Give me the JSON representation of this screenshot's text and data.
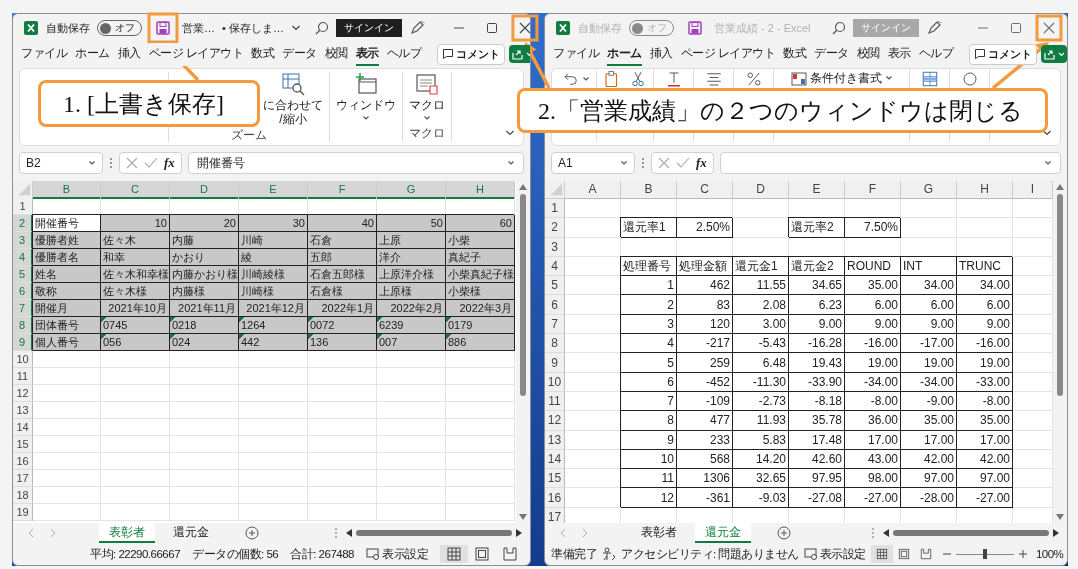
{
  "windows": [
    {
      "active": true,
      "autosave": {
        "label": "自動保存",
        "state_text": "オフ",
        "on": false
      },
      "title_parts": [
        "営業…",
        "• 保存しま…"
      ],
      "title_menu": true,
      "signin": "サインイン",
      "menu_tabs": [
        {
          "label": "ファイル",
          "selected": false
        },
        {
          "label": "ホーム",
          "selected": false
        },
        {
          "label": "挿入",
          "selected": false
        },
        {
          "label": "ページ レイアウト",
          "selected": false
        },
        {
          "label": "数式",
          "selected": false
        },
        {
          "label": "データ",
          "selected": false
        },
        {
          "label": "校閲",
          "selected": false
        },
        {
          "label": "表示",
          "selected": true
        },
        {
          "label": "ヘルプ",
          "selected": false
        }
      ],
      "comment_button": "コメント",
      "ribbon": [
        {
          "label": "ズーム",
          "buttons": [
            {
              "kind": "zoomfit",
              "label": "に合わせて\n/縮小",
              "menu": false
            }
          ]
        },
        {
          "buttons": [
            {
              "kind": "window",
              "label": "ウィンドウ",
              "menu": true
            }
          ]
        },
        {
          "label": "マクロ",
          "buttons": [
            {
              "kind": "macro",
              "label": "マクロ",
              "menu": true
            }
          ]
        }
      ],
      "name_box": "B2",
      "fx": "fx",
      "formula": "開催番号",
      "columns": [
        {
          "label": "B",
          "selected": true
        },
        {
          "label": "C",
          "selected": true
        },
        {
          "label": "D",
          "selected": true
        },
        {
          "label": "E",
          "selected": true
        },
        {
          "label": "F",
          "selected": true
        },
        {
          "label": "G",
          "selected": true
        },
        {
          "label": "H",
          "selected": true
        }
      ],
      "rows": [
        {
          "header": "1",
          "selected": false
        },
        {
          "header": "2",
          "selected": true,
          "bordered": true,
          "cells": [
            {
              "text": "開催番号",
              "active": true
            },
            {
              "text": "10",
              "numeric": true
            },
            {
              "text": "20",
              "numeric": true
            },
            {
              "text": "30",
              "numeric": true
            },
            {
              "text": "40",
              "numeric": true
            },
            {
              "text": "50",
              "numeric": true
            },
            {
              "text": "60",
              "numeric": true
            }
          ]
        },
        {
          "header": "3",
          "selected": true,
          "bordered": true,
          "cells": [
            "優勝者姓",
            "佐々木",
            "内藤",
            "川崎",
            "石倉",
            "上原",
            "小柴"
          ]
        },
        {
          "header": "4",
          "selected": true,
          "bordered": true,
          "cells": [
            "優勝者名",
            "和幸",
            "かおり",
            "綾",
            "五郎",
            "洋介",
            "真紀子"
          ]
        },
        {
          "header": "5",
          "selected": true,
          "bordered": true,
          "cells": [
            "姓名",
            "佐々木和幸様",
            "内藤かおり様",
            "川崎綾様",
            "石倉五郎様",
            "上原洋介様",
            "小柴真紀子様"
          ]
        },
        {
          "header": "6",
          "selected": true,
          "bordered": true,
          "cells": [
            "敬称",
            "佐々木様",
            "内藤様",
            "川崎様",
            "石倉様",
            "上原様",
            "小柴様"
          ]
        },
        {
          "header": "7",
          "selected": true,
          "bordered": true,
          "cells": [
            "開催月",
            {
              "text": "2021年10月",
              "numeric": true
            },
            {
              "text": "2021年11月",
              "numeric": true
            },
            {
              "text": "2021年12月",
              "numeric": true
            },
            {
              "text": "2022年1月",
              "numeric": true
            },
            {
              "text": "2022年2月",
              "numeric": true
            },
            {
              "text": "2022年3月",
              "numeric": true
            }
          ]
        },
        {
          "header": "8",
          "selected": true,
          "bordered": true,
          "cells": [
            "団体番号",
            {
              "text": "0745",
              "flag": true
            },
            {
              "text": "0218",
              "flag": true
            },
            {
              "text": "1264",
              "flag": true
            },
            {
              "text": "0072",
              "flag": true
            },
            {
              "text": "6239",
              "flag": true
            },
            {
              "text": "0179",
              "flag": true
            }
          ]
        },
        {
          "header": "9",
          "selected": true,
          "bordered": true,
          "cells": [
            "個人番号",
            {
              "text": "056",
              "flag": true
            },
            {
              "text": "024",
              "flag": true
            },
            {
              "text": "442",
              "flag": true
            },
            {
              "text": "136",
              "flag": true
            },
            {
              "text": "007",
              "flag": true
            },
            {
              "text": "886",
              "flag": true
            }
          ]
        },
        {
          "header": "10",
          "selected": false
        },
        {
          "header": "11",
          "selected": false
        },
        {
          "header": "12",
          "selected": false
        },
        {
          "header": "13",
          "selected": false
        },
        {
          "header": "14",
          "selected": false
        },
        {
          "header": "15",
          "selected": false
        },
        {
          "header": "16",
          "selected": false
        },
        {
          "header": "17",
          "selected": false
        },
        {
          "header": "18",
          "selected": false
        },
        {
          "header": "19",
          "selected": false
        }
      ],
      "sheet_tabs": [
        {
          "label": "表彰者",
          "selected": true
        },
        {
          "label": "還元金",
          "selected": false
        }
      ],
      "status": [
        {
          "kind": "stat",
          "text": "平均: 22290.66667"
        },
        {
          "kind": "stat",
          "text": "データの個数: 56"
        },
        {
          "kind": "stat",
          "text": "合計: 267488"
        }
      ],
      "view_settings": "表示設定"
    },
    {
      "active": false,
      "autosave": {
        "label": "自動保存",
        "state_text": "オフ",
        "on": false
      },
      "title_parts": [
        "営業成績 - 2 - Excel"
      ],
      "title_menu": false,
      "signin": "サインイン",
      "menu_tabs": [
        {
          "label": "ファイル",
          "selected": false
        },
        {
          "label": "ホーム",
          "selected": true
        },
        {
          "label": "挿入",
          "selected": false
        },
        {
          "label": "ページ レイアウト",
          "selected": false
        },
        {
          "label": "数式",
          "selected": false
        },
        {
          "label": "データ",
          "selected": false
        },
        {
          "label": "校閲",
          "selected": false
        },
        {
          "label": "表示",
          "selected": false
        },
        {
          "label": "ヘルプ",
          "selected": false
        }
      ],
      "comment_button": "コメント",
      "ribbon": [
        {
          "buttons": [
            {
              "kind": "undo",
              "menu": true
            }
          ]
        },
        {
          "buttons": [
            {
              "kind": "paste",
              "menu": false
            },
            {
              "kind": "cut",
              "menu": false
            }
          ]
        },
        {
          "buttons": [
            {
              "kind": "font",
              "menu": false
            }
          ]
        },
        {
          "buttons": [
            {
              "kind": "align",
              "menu": false
            }
          ]
        },
        {
          "buttons": [
            {
              "kind": "number",
              "menu": false
            }
          ]
        },
        {
          "buttons": [
            {
              "kind": "condfmt",
              "label": "条件付き書式",
              "menu": true
            }
          ]
        },
        {
          "buttons": [
            {
              "kind": "cells",
              "menu": false
            }
          ]
        },
        {
          "buttons": [
            {
              "kind": "editing",
              "menu": false
            }
          ]
        }
      ],
      "name_box": "A1",
      "fx": "fx",
      "columns": [
        {
          "label": "A",
          "selected": false
        },
        {
          "label": "B",
          "selected": false
        },
        {
          "label": "C",
          "selected": false
        },
        {
          "label": "D",
          "selected": false
        },
        {
          "label": "E",
          "selected": false
        },
        {
          "label": "F",
          "selected": false
        },
        {
          "label": "G",
          "selected": false
        },
        {
          "label": "H",
          "selected": false
        },
        {
          "label": "I",
          "selected": false
        }
      ],
      "rows": [
        {
          "header": "1",
          "selected": false
        },
        {
          "header": "2",
          "selected": false,
          "bordered": true,
          "cells": [
            {},
            "還元率1",
            {
              "text": "2.50%",
              "numeric": true
            },
            {},
            "還元率2",
            {
              "text": "7.50%",
              "numeric": true
            }
          ]
        },
        {
          "header": "3",
          "selected": false
        },
        {
          "header": "4",
          "selected": false,
          "bordered": true,
          "cells": [
            {},
            "処理番号",
            "処理金額",
            "還元金1",
            "還元金2",
            "ROUND",
            "INT",
            "TRUNC"
          ]
        },
        {
          "header": "5",
          "selected": false,
          "bordered": true,
          "numeric": true,
          "cells": [
            {},
            "1",
            "462",
            "11.55",
            "34.65",
            "35.00",
            "34.00",
            "34.00"
          ]
        },
        {
          "header": "6",
          "selected": false,
          "bordered": true,
          "numeric": true,
          "cells": [
            {},
            "2",
            "83",
            "2.08",
            "6.23",
            "6.00",
            "6.00",
            "6.00"
          ]
        },
        {
          "header": "7",
          "selected": false,
          "bordered": true,
          "numeric": true,
          "cells": [
            {},
            "3",
            "120",
            "3.00",
            "9.00",
            "9.00",
            "9.00",
            "9.00"
          ]
        },
        {
          "header": "8",
          "selected": false,
          "bordered": true,
          "numeric": true,
          "cells": [
            {},
            "4",
            "-217",
            "-5.43",
            "-16.28",
            "-16.00",
            "-17.00",
            "-16.00"
          ]
        },
        {
          "header": "9",
          "selected": false,
          "bordered": true,
          "numeric": true,
          "cells": [
            {},
            "5",
            "259",
            "6.48",
            "19.43",
            "19.00",
            "19.00",
            "19.00"
          ]
        },
        {
          "header": "10",
          "selected": false,
          "bordered": true,
          "numeric": true,
          "cells": [
            {},
            "6",
            "-452",
            "-11.30",
            "-33.90",
            "-34.00",
            "-34.00",
            "-33.00"
          ]
        },
        {
          "header": "11",
          "selected": false,
          "bordered": true,
          "numeric": true,
          "cells": [
            {},
            "7",
            "-109",
            "-2.73",
            "-8.18",
            "-8.00",
            "-9.00",
            "-8.00"
          ]
        },
        {
          "header": "12",
          "selected": false,
          "bordered": true,
          "numeric": true,
          "cells": [
            {},
            "8",
            "477",
            "11.93",
            "35.78",
            "36.00",
            "35.00",
            "35.00"
          ]
        },
        {
          "header": "13",
          "selected": false,
          "bordered": true,
          "numeric": true,
          "cells": [
            {},
            "9",
            "233",
            "5.83",
            "17.48",
            "17.00",
            "17.00",
            "17.00"
          ]
        },
        {
          "header": "14",
          "selected": false,
          "bordered": true,
          "numeric": true,
          "cells": [
            {},
            "10",
            "568",
            "14.20",
            "42.60",
            "43.00",
            "42.00",
            "42.00"
          ]
        },
        {
          "header": "15",
          "selected": false,
          "bordered": true,
          "numeric": true,
          "cells": [
            {},
            "11",
            "1306",
            "32.65",
            "97.95",
            "98.00",
            "97.00",
            "97.00"
          ]
        },
        {
          "header": "16",
          "selected": false,
          "bordered": true,
          "numeric": true,
          "cells": [
            {},
            "12",
            "-361",
            "-9.03",
            "-27.08",
            "-27.00",
            "-28.00",
            "-27.00"
          ]
        },
        {
          "header": "17",
          "selected": false
        }
      ],
      "sheet_tabs": [
        {
          "label": "表彰者",
          "selected": false
        },
        {
          "label": "還元金",
          "selected": true
        }
      ],
      "status": [
        {
          "kind": "text",
          "text": "準備完了"
        },
        {
          "kind": "accessibility",
          "text": "アクセシビリティ: 問題ありません"
        }
      ],
      "view_settings": "表示設定",
      "zoom": {
        "level": 0.5,
        "text": "100%"
      }
    }
  ],
  "callouts": [
    {
      "text": "1. [上書き保存]"
    },
    {
      "text": "2.「営業成績」の２つのウィンドウは閉じる"
    }
  ]
}
